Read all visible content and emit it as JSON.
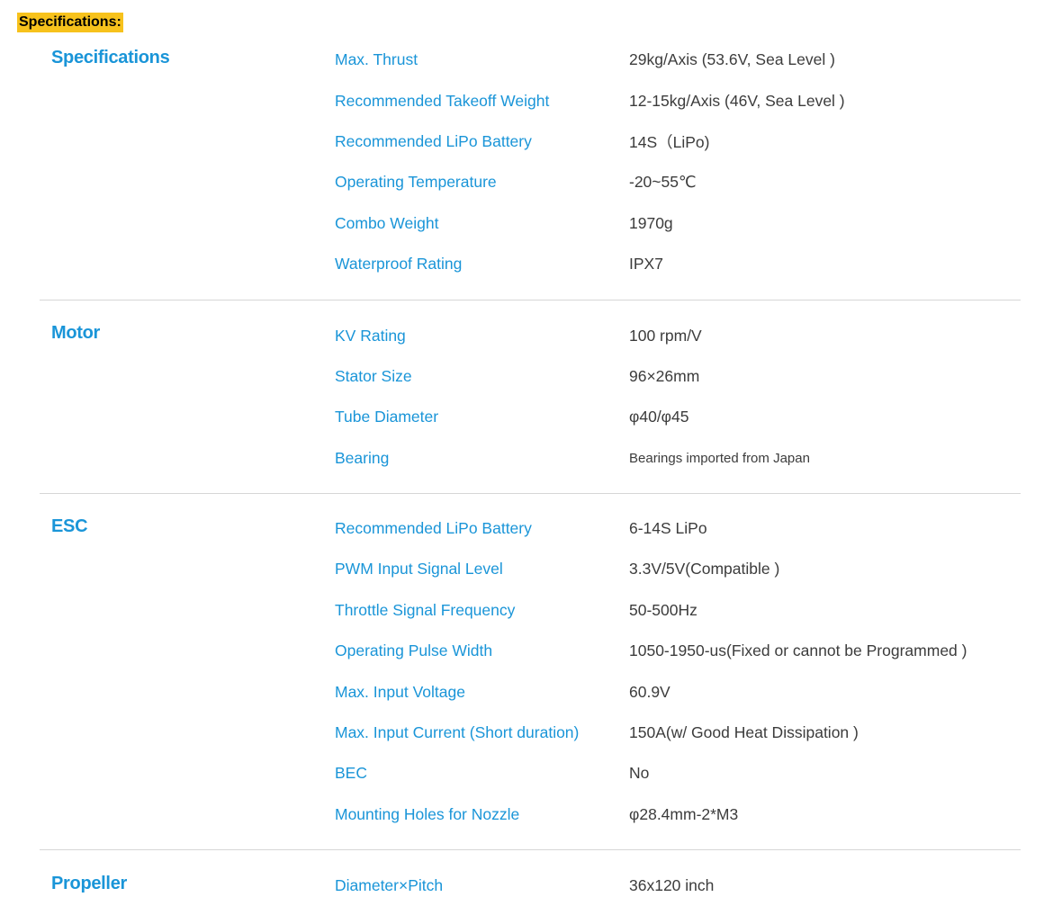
{
  "header": {
    "label": "Specifications:"
  },
  "colors": {
    "accent": "#1a95d8",
    "text": "#3c3c3c",
    "highlight": "#f7c21c",
    "divider": "#d6d6d6"
  },
  "sections": [
    {
      "title": "Specifications",
      "rows": [
        {
          "label": "Max. Thrust",
          "value": "29kg/Axis (53.6V, Sea Level )"
        },
        {
          "label": "Recommended Takeoff Weight",
          "value": "12-15kg/Axis (46V, Sea Level )"
        },
        {
          "label": "Recommended LiPo Battery",
          "value": "14S（LiPo)"
        },
        {
          "label": "Operating Temperature",
          "value": "-20~55℃"
        },
        {
          "label": "Combo Weight",
          "value": "1970g"
        },
        {
          "label": "Waterproof Rating",
          "value": "IPX7"
        }
      ]
    },
    {
      "title": "Motor",
      "rows": [
        {
          "label": "KV Rating",
          "value": "100 rpm/V"
        },
        {
          "label": "Stator Size",
          "value": "96×26mm"
        },
        {
          "label": "Tube Diameter",
          "value": "φ40/φ45"
        },
        {
          "label": "Bearing",
          "value": "Bearings imported from Japan"
        }
      ]
    },
    {
      "title": "ESC",
      "rows": [
        {
          "label": "Recommended LiPo Battery",
          "value": "6-14S LiPo"
        },
        {
          "label": "PWM Input Signal Level",
          "value": "3.3V/5V(Compatible )"
        },
        {
          "label": "Throttle Signal Frequency",
          "value": "50-500Hz"
        },
        {
          "label": "Operating Pulse Width",
          "value": "1050-1950-us(Fixed or cannot be Programmed )"
        },
        {
          "label": "Max. Input Voltage",
          "value": "60.9V"
        },
        {
          "label": "Max. Input Current (Short duration)",
          "value": "150A(w/ Good Heat Dissipation )"
        },
        {
          "label": "BEC",
          "value": "No"
        },
        {
          "label": "Mounting Holes for Nozzle",
          "value": "φ28.4mm-2*M3"
        }
      ]
    },
    {
      "title": "Propeller",
      "rows": [
        {
          "label": "Diameter×Pitch",
          "value": "36x120 inch"
        }
      ]
    }
  ]
}
